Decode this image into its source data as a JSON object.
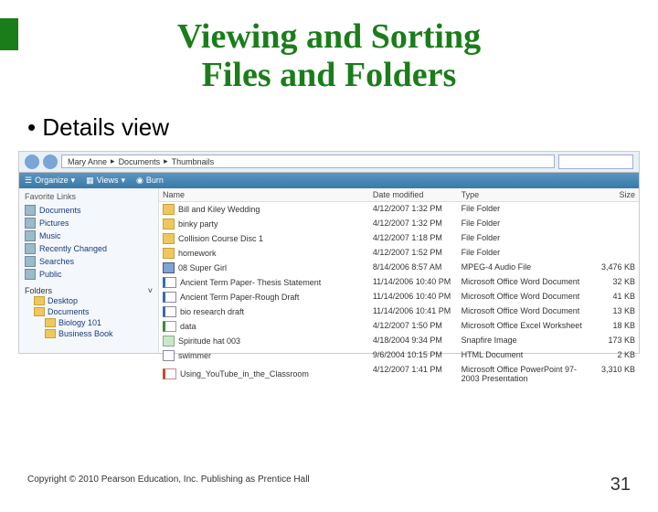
{
  "title_line1": "Viewing and Sorting",
  "title_line2": "Files and Folders",
  "bullet": "Details view",
  "breadcrumb": [
    "Mary Anne",
    "Documents",
    "Thumbnails"
  ],
  "toolbar": {
    "organize": "Organize",
    "views": "Views",
    "burn": "Burn"
  },
  "navpane": {
    "favorite_links_header": "Favorite Links",
    "links": [
      "Documents",
      "Pictures",
      "Music",
      "Recently Changed",
      "Searches",
      "Public"
    ],
    "folders_header": "Folders",
    "tree": [
      "Desktop",
      "Documents",
      "Biology 101",
      "Business Book"
    ]
  },
  "columns": {
    "name": "Name",
    "date": "Date modified",
    "type": "Type",
    "size": "Size"
  },
  "files": [
    {
      "name": "Bill and Kiley Wedding",
      "date": "4/12/2007 1:32 PM",
      "type": "File Folder",
      "size": "",
      "icon": "folder"
    },
    {
      "name": "binky party",
      "date": "4/12/2007 1:32 PM",
      "type": "File Folder",
      "size": "",
      "icon": "folder"
    },
    {
      "name": "Collision Course Disc 1",
      "date": "4/12/2007 1:18 PM",
      "type": "File Folder",
      "size": "",
      "icon": "folder"
    },
    {
      "name": "homework",
      "date": "4/12/2007 1:52 PM",
      "type": "File Folder",
      "size": "",
      "icon": "folder"
    },
    {
      "name": "08 Super Girl",
      "date": "8/14/2006 8:57 AM",
      "type": "MPEG-4 Audio File",
      "size": "3,476 KB",
      "icon": "audio"
    },
    {
      "name": "Ancient Term Paper- Thesis Statement",
      "date": "11/14/2006 10:40 PM",
      "type": "Microsoft Office Word Document",
      "size": "32 KB",
      "icon": "word"
    },
    {
      "name": "Ancient Term Paper-Rough Draft",
      "date": "11/14/2006 10:40 PM",
      "type": "Microsoft Office Word Document",
      "size": "41 KB",
      "icon": "word"
    },
    {
      "name": "bio research draft",
      "date": "11/14/2006 10:41 PM",
      "type": "Microsoft Office Word Document",
      "size": "13 KB",
      "icon": "word"
    },
    {
      "name": "data",
      "date": "4/12/2007 1:50 PM",
      "type": "Microsoft Office Excel Worksheet",
      "size": "18 KB",
      "icon": "excel"
    },
    {
      "name": "Spiritude hat 003",
      "date": "4/18/2004 9:34 PM",
      "type": "Snapfire Image",
      "size": "173 KB",
      "icon": "image"
    },
    {
      "name": "swimmer",
      "date": "9/6/2004 10:15 PM",
      "type": "HTML Document",
      "size": "2 KB",
      "icon": "html"
    },
    {
      "name": "Using_YouTube_in_the_Classroom",
      "date": "4/12/2007 1:41 PM",
      "type": "Microsoft Office PowerPoint 97-2003 Presentation",
      "size": "3,310 KB",
      "icon": "ppt"
    }
  ],
  "footer": {
    "copyright": "Copyright © 2010 Pearson Education, Inc. Publishing as Prentice Hall",
    "page": "31"
  }
}
